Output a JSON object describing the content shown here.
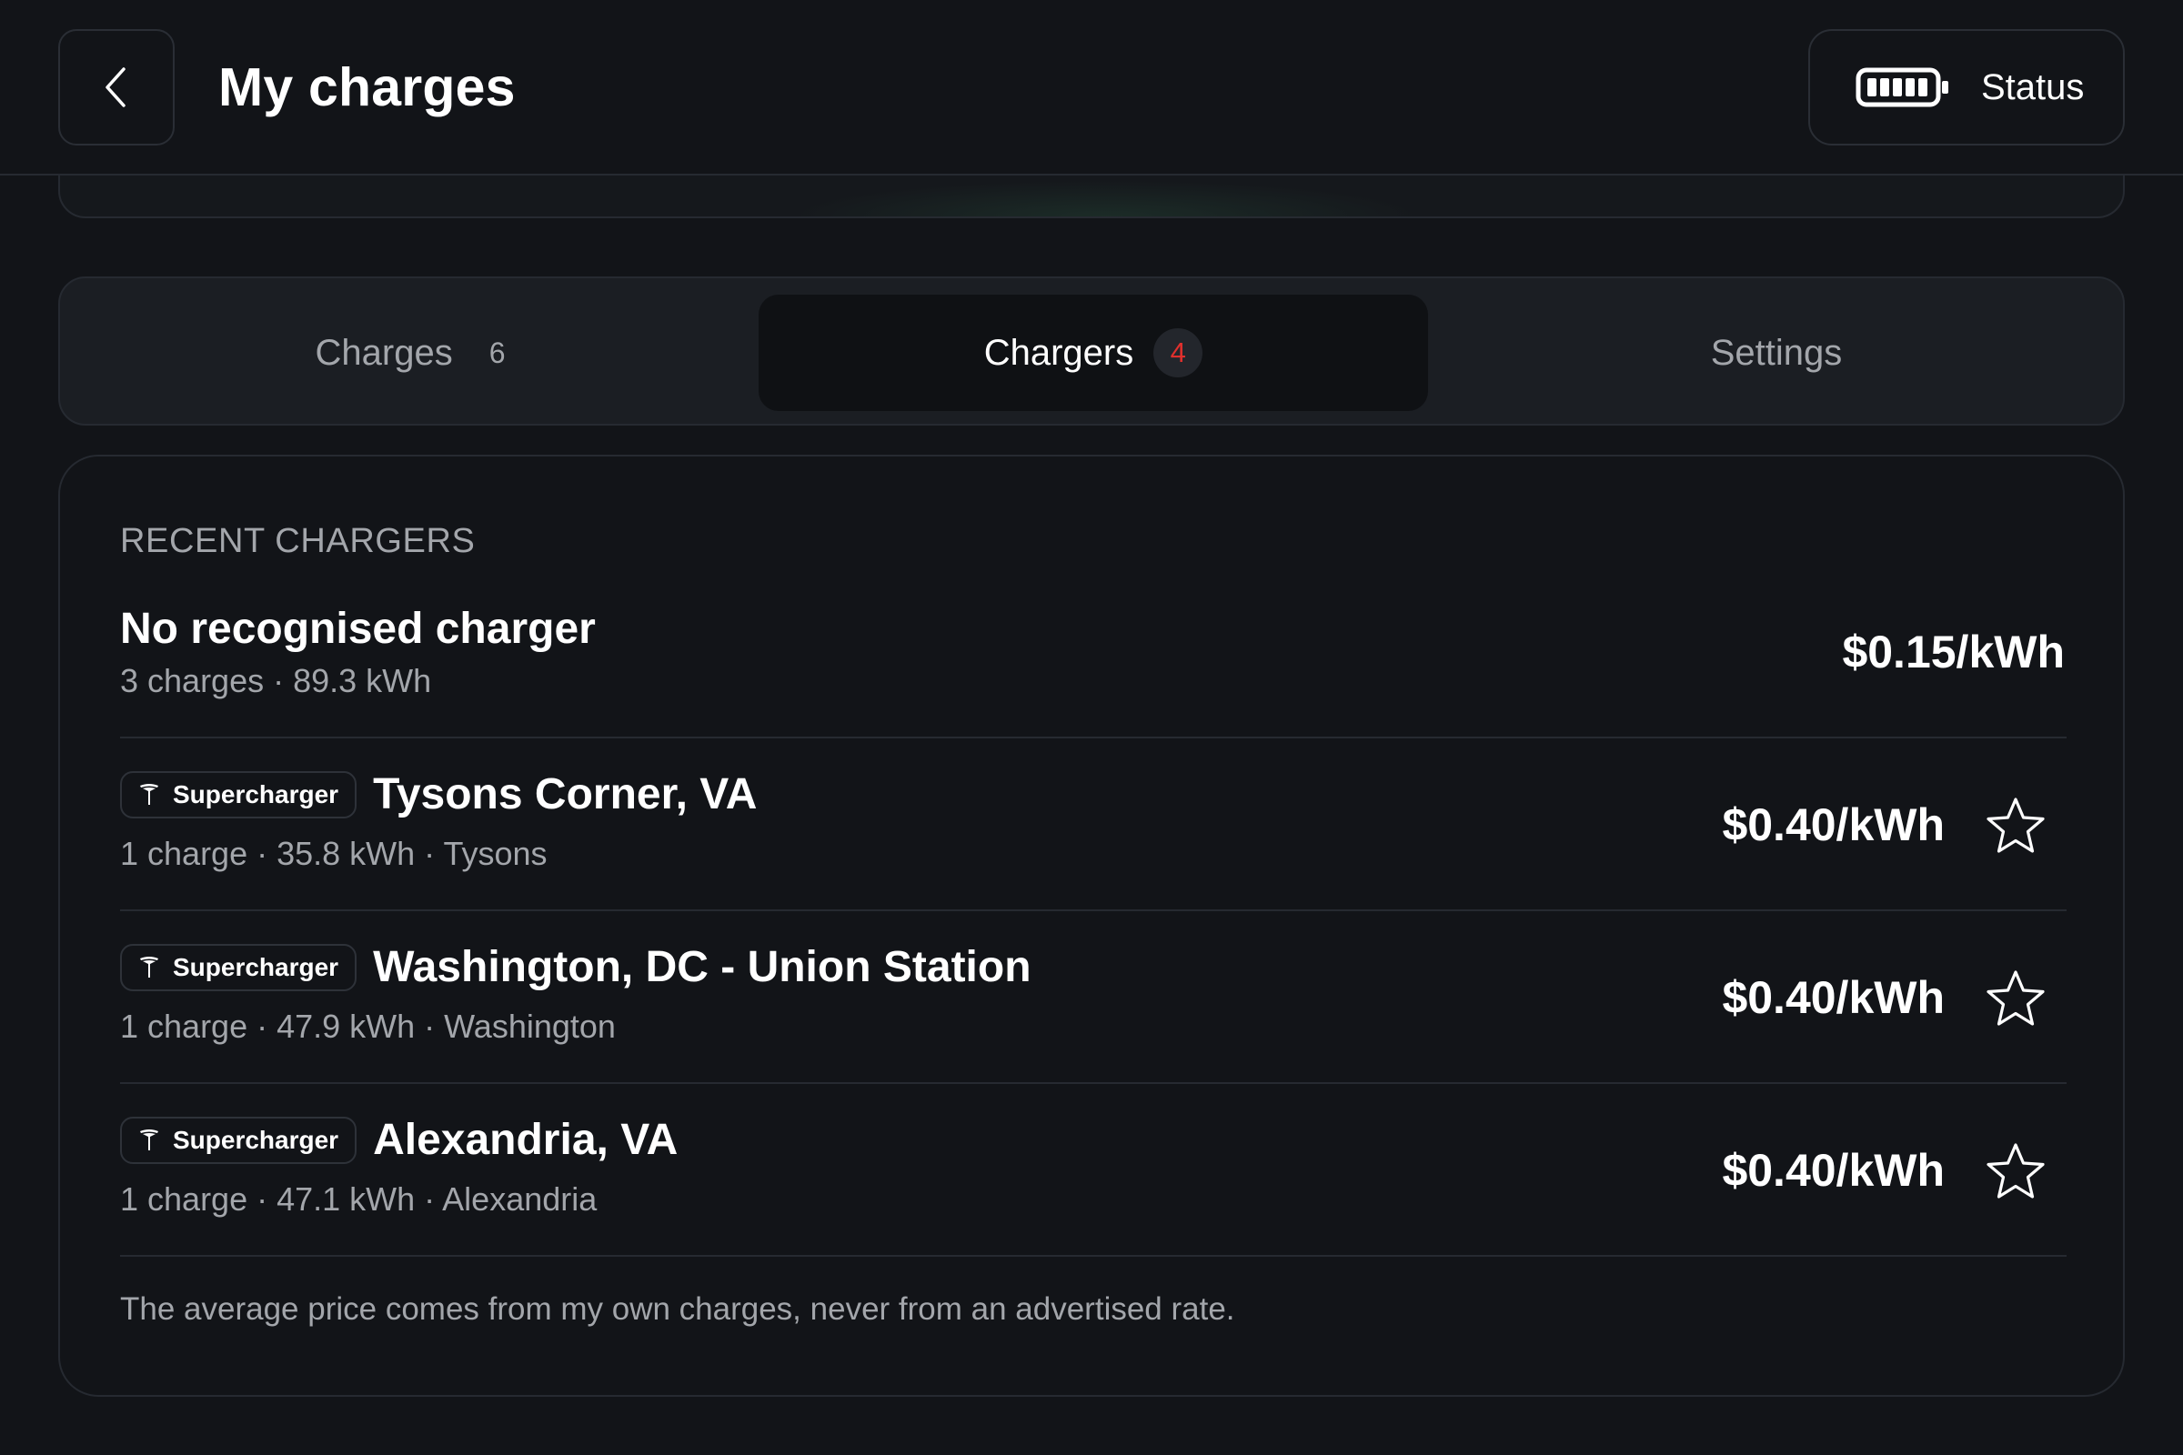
{
  "header": {
    "title": "My charges",
    "back_icon": "chevron-left-icon",
    "status_label": "Status",
    "status_icon": "battery-icon"
  },
  "tabs": [
    {
      "label": "Charges",
      "count": "6",
      "active": false
    },
    {
      "label": "Chargers",
      "count": "4",
      "active": true
    },
    {
      "label": "Settings",
      "count": "",
      "active": false
    }
  ],
  "recent_chargers": {
    "section_title": "RECENT CHARGERS",
    "items": [
      {
        "name": "No recognised charger",
        "subtitle": "3 charges · 89.3 kWh",
        "price": "$0.15/kWh",
        "tag": "",
        "favorite": false
      },
      {
        "name": "Tysons Corner, VA",
        "subtitle": "1 charge · 35.8 kWh · Tysons",
        "price": "$0.40/kWh",
        "tag": "Supercharger",
        "favorite": false
      },
      {
        "name": "Washington, DC - Union Station",
        "subtitle": "1 charge · 47.9 kWh · Washington",
        "price": "$0.40/kWh",
        "tag": "Supercharger",
        "favorite": false
      },
      {
        "name": "Alexandria, VA",
        "subtitle": "1 charge · 47.1 kWh · Alexandria",
        "price": "$0.40/kWh",
        "tag": "Supercharger",
        "favorite": false
      }
    ],
    "footnote": "The average price comes from my own charges, never from an advertised rate."
  },
  "colors": {
    "background": "#121418",
    "border": "#262a31",
    "muted_text": "#a3a6ab",
    "badge_red": "#e0302d"
  }
}
